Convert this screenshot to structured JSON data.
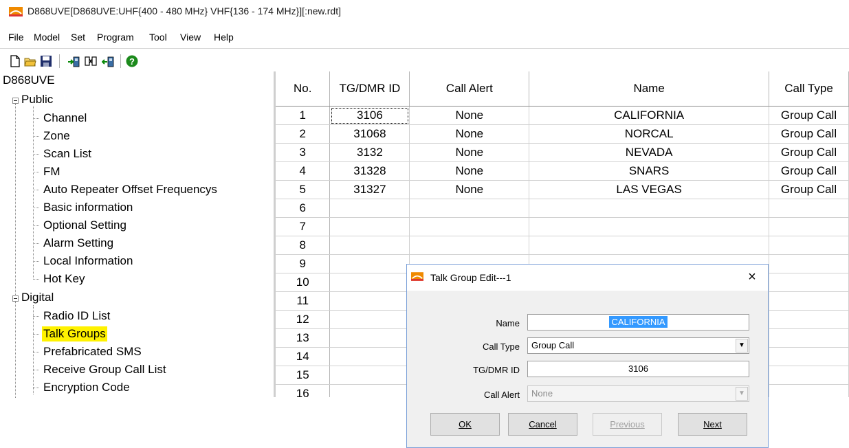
{
  "window": {
    "title": "D868UVE[D868UVE:UHF{400 - 480 MHz} VHF{136 - 174 MHz}][:new.rdt]"
  },
  "menu": [
    "File",
    "Model",
    "Set",
    "Program",
    "Tool",
    "View",
    "Help"
  ],
  "toolbar": {
    "icons": [
      "new-file-icon",
      "open-folder-icon",
      "save-disk-icon",
      "read-from-radio-icon",
      "channel-tool-icon",
      "write-to-radio-icon",
      "help-icon"
    ]
  },
  "tree": {
    "root": "D868UVE",
    "public": {
      "label": "Public",
      "items": [
        "Channel",
        "Zone",
        "Scan List",
        "FM",
        "Auto Repeater Offset Frequencys",
        "Basic information",
        "Optional Setting",
        "Alarm Setting",
        "Local Information",
        "Hot Key"
      ]
    },
    "digital": {
      "label": "Digital",
      "items": [
        "Radio ID List",
        "Talk Groups",
        "Prefabricated SMS",
        "Receive Group Call List",
        "Encryption Code"
      ]
    },
    "selected": "Talk Groups"
  },
  "table": {
    "headers": [
      "No.",
      "TG/DMR ID",
      "Call Alert",
      "Name",
      "Call Type"
    ],
    "rows": [
      [
        "1",
        "3106",
        "None",
        "CALIFORNIA",
        "Group Call"
      ],
      [
        "2",
        "31068",
        "None",
        "NORCAL",
        "Group Call"
      ],
      [
        "3",
        "3132",
        "None",
        "NEVADA",
        "Group Call"
      ],
      [
        "4",
        "31328",
        "None",
        "SNARS",
        "Group Call"
      ],
      [
        "5",
        "31327",
        "None",
        "LAS VEGAS",
        "Group Call"
      ],
      [
        "6",
        "",
        "",
        "",
        ""
      ],
      [
        "7",
        "",
        "",
        "",
        ""
      ],
      [
        "8",
        "",
        "",
        "",
        ""
      ],
      [
        "9",
        "",
        "",
        "",
        ""
      ],
      [
        "10",
        "",
        "",
        "",
        ""
      ],
      [
        "11",
        "",
        "",
        "",
        ""
      ],
      [
        "12",
        "",
        "",
        "",
        ""
      ],
      [
        "13",
        "",
        "",
        "",
        ""
      ],
      [
        "14",
        "",
        "",
        "",
        ""
      ],
      [
        "15",
        "",
        "",
        "",
        ""
      ],
      [
        "16",
        "",
        "",
        "",
        ""
      ]
    ]
  },
  "dialog": {
    "title": "Talk Group Edit---1",
    "close": "×",
    "fields": {
      "name_label": "Name",
      "name_value": "CALIFORNIA",
      "call_type_label": "Call Type",
      "call_type_value": "Group Call",
      "tg_id_label": "TG/DMR ID",
      "tg_id_value": "3106",
      "call_alert_label": "Call Alert",
      "call_alert_value": "None"
    },
    "buttons": {
      "ok": "OK",
      "cancel": "Cancel",
      "previous": "Previous",
      "next": "Next"
    }
  },
  "colors": {
    "tree_highlight": "#fff200",
    "selection_blue": "#3399ff",
    "app_icon_orange": "#f08a00"
  }
}
